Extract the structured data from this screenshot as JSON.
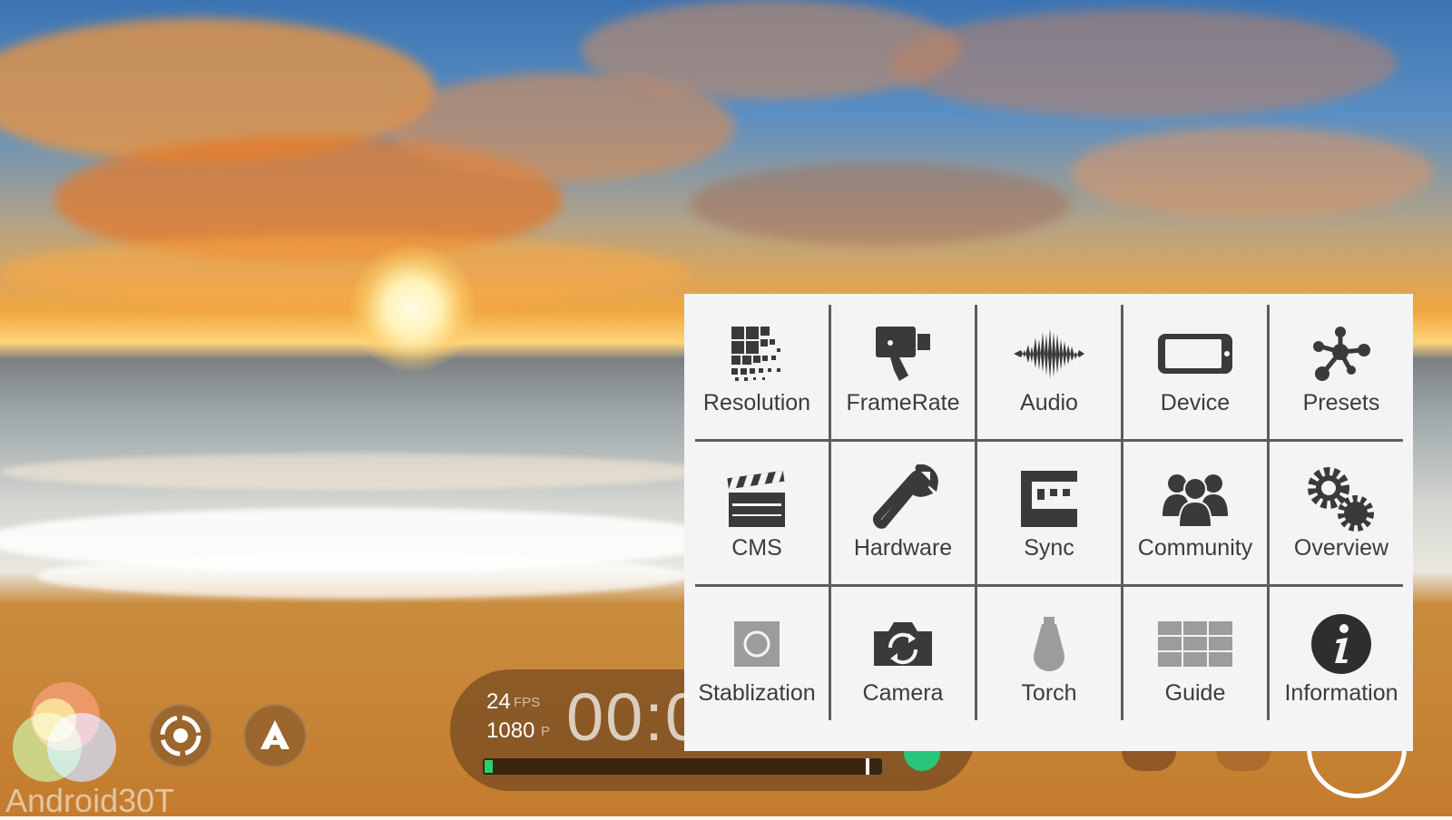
{
  "watermark": "Android30T",
  "hud": {
    "fps_value": "24",
    "fps_unit": "FPS",
    "res_value": "1080",
    "res_unit": "P",
    "timecode": "00:0",
    "audio_level": 0.02,
    "color_accent": "#2ecf6b"
  },
  "menu": {
    "items": [
      {
        "label": "Resolution",
        "icon": "resolution-grid-icon"
      },
      {
        "label": "FrameRate",
        "icon": "movie-camera-icon"
      },
      {
        "label": "Audio",
        "icon": "waveform-icon"
      },
      {
        "label": "Device",
        "icon": "phone-landscape-icon"
      },
      {
        "label": "Presets",
        "icon": "nodes-icon"
      },
      {
        "label": "CMS",
        "icon": "clapperboard-icon"
      },
      {
        "label": "Hardware",
        "icon": "wrench-icon"
      },
      {
        "label": "Sync",
        "icon": "sync-icon"
      },
      {
        "label": "Community",
        "icon": "people-icon"
      },
      {
        "label": "Overview",
        "icon": "gears-icon"
      },
      {
        "label": "Stablization",
        "icon": "stabilization-icon"
      },
      {
        "label": "Camera",
        "icon": "camera-switch-icon"
      },
      {
        "label": "Torch",
        "icon": "torch-bulb-icon"
      },
      {
        "label": "Guide",
        "icon": "guide-grid-icon"
      },
      {
        "label": "Information",
        "icon": "info-icon"
      }
    ]
  }
}
